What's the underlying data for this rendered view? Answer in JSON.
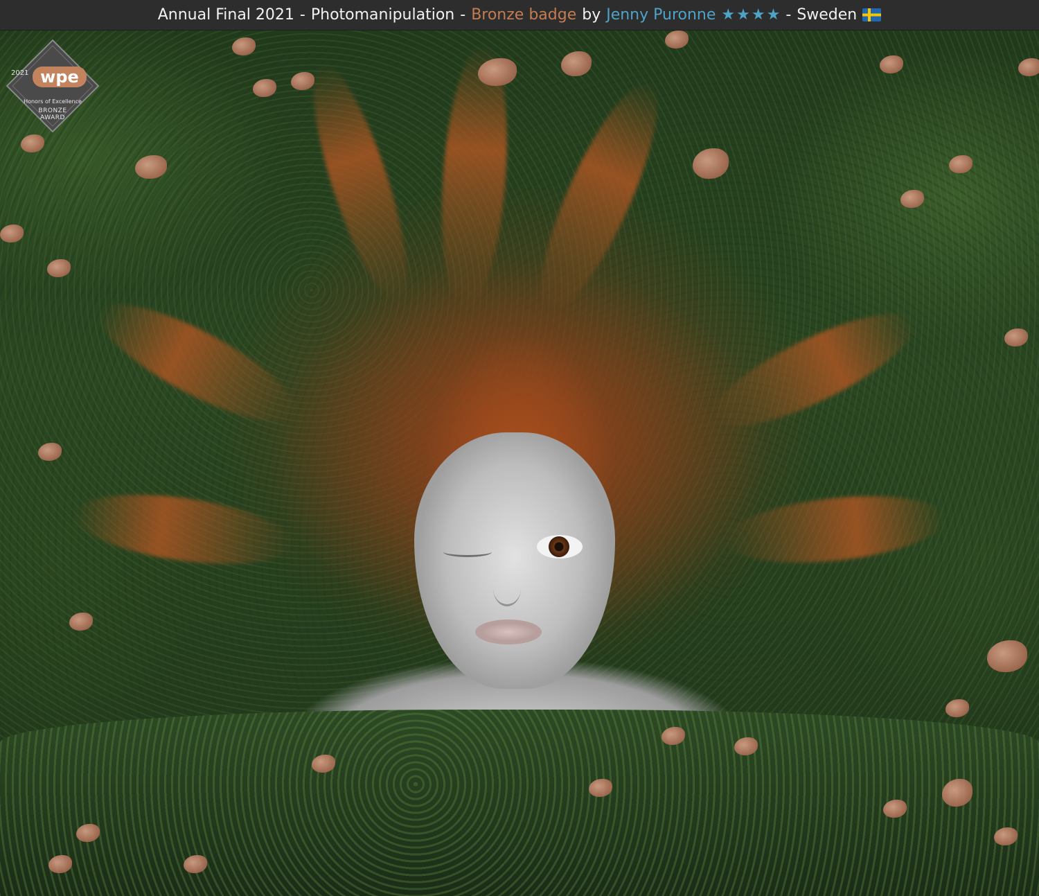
{
  "header": {
    "competition": "Annual Final 2021",
    "separator_1": "-",
    "category": "Photomanipulation",
    "separator_2": "-",
    "badge_label": "Bronze badge",
    "by_label": "by",
    "photographer": "Jenny Puronne",
    "star_rating": 4,
    "stars": [
      "★",
      "★",
      "★",
      "★"
    ],
    "separator_3": "-",
    "country": "Sweden",
    "flag_icon": "sweden-flag-icon",
    "colors": {
      "bar_background": "#2d2d2d",
      "text": "#f2f2f2",
      "badge": "#c47c53",
      "photographer": "#4fa3c7",
      "stars": "#4fa3c7"
    }
  },
  "award_badge": {
    "year": "2021",
    "logo": "wpe",
    "honors": "Honors of Excellence",
    "award_line_1": "BRONZE",
    "award_line_2": "AWARD",
    "colors": {
      "badge_background": "#4a4a4a",
      "logo": "#c4835f"
    }
  },
  "photo": {
    "subject_icon": "portrait-photo"
  }
}
